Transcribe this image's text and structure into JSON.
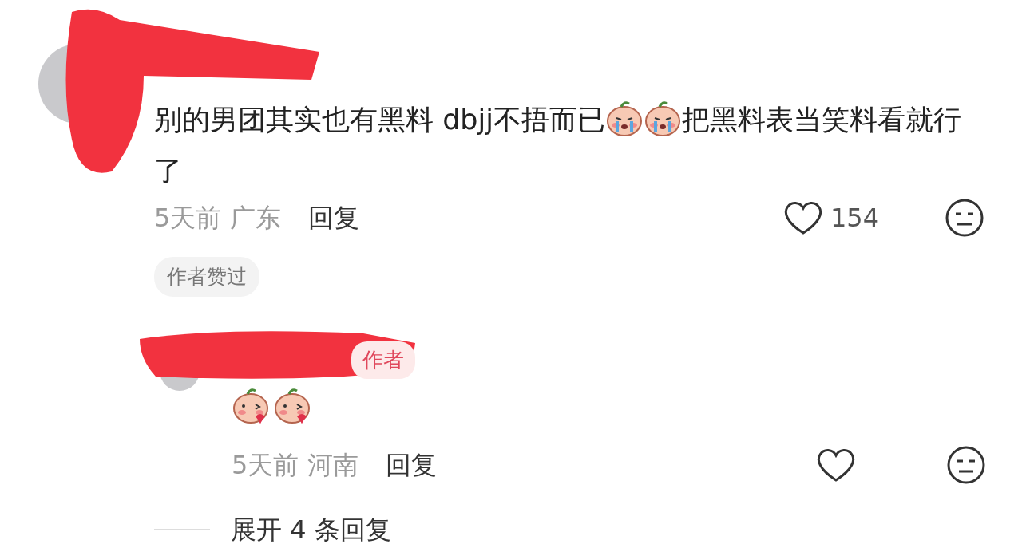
{
  "comment": {
    "segments": [
      {
        "kind": "text",
        "text": "别的男团其实也有黑料 dbjj不捂而已"
      },
      {
        "kind": "emoji"
      },
      {
        "kind": "emoji"
      },
      {
        "kind": "text",
        "text": "把黑料表当笑料看就行了"
      }
    ],
    "time": "5天前",
    "location": "广东",
    "reply_label": "回复",
    "liked": false,
    "likes": "154",
    "badge": "作者赞过"
  },
  "reply": {
    "author_tag": "作者",
    "emojis": [
      {
        "kind": "emoji"
      },
      {
        "kind": "emoji"
      }
    ],
    "time": "5天前",
    "location": "河南",
    "reply_label": "回复",
    "liked": false
  },
  "expand": {
    "label": "展开 4 条回复"
  }
}
